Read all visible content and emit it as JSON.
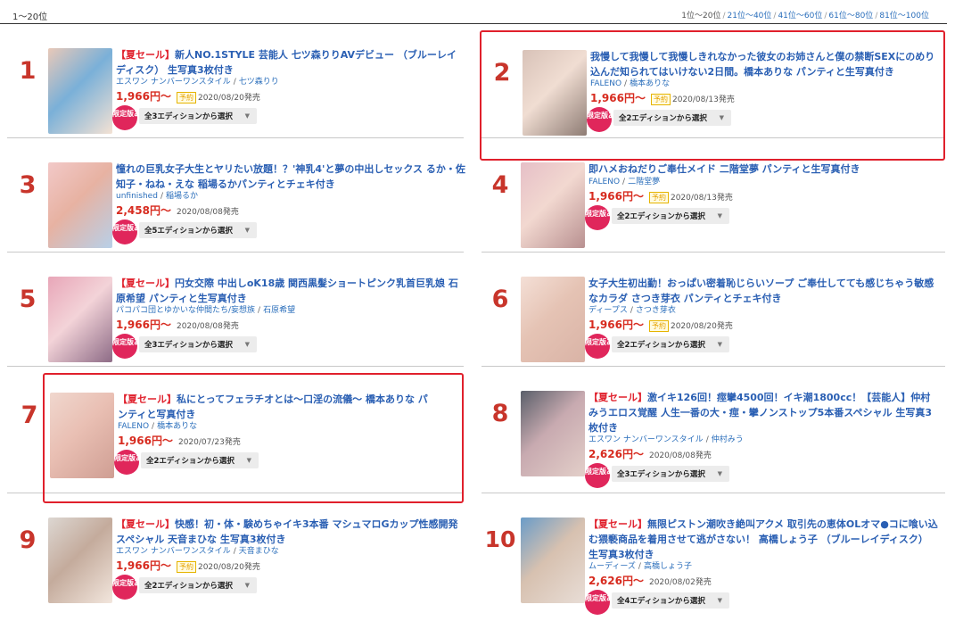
{
  "header": {
    "range_label": "1〜20位",
    "pagination": [
      {
        "label": "1位〜20位",
        "current": true
      },
      {
        "label": "21位〜40位",
        "current": false
      },
      {
        "label": "41位〜60位",
        "current": false
      },
      {
        "label": "61位〜80位",
        "current": false
      },
      {
        "label": "81位〜100位",
        "current": false
      }
    ]
  },
  "colors": {
    "accent_red": "#e0202c",
    "link_blue": "#2a5fb3",
    "rank_red": "#c8352b",
    "badge_pink": "#e0265b",
    "price_red": "#d72b1f"
  },
  "ui": {
    "limited_badge": "限定版あり",
    "dropdown_arrow": "▼",
    "slash": "/"
  },
  "items": [
    {
      "rank": "1",
      "sale": "【夏セール】",
      "title": "新人NO.1STYLE 芸能人 七ツ森りりAVデビュー （ブルーレイディスク） 生写真3枚付き",
      "maker": "エスワン ナンバーワンスタイル",
      "actress": "七ツ森りり",
      "price": "1,966円〜",
      "reserve": "予約",
      "date": "2020/08/20発売",
      "edition": "全3エディションから選択",
      "highlighted": false
    },
    {
      "rank": "2",
      "sale": "",
      "title": "我慢して我慢して我慢しきれなかった彼女のお姉さんと僕の禁断SEXにのめり込んだ知られてはいけない2日間。橋本ありな パンティと生写真付き",
      "maker": "FALENO",
      "actress": "橋本ありな",
      "price": "1,966円〜",
      "reserve": "予約",
      "date": "2020/08/13発売",
      "edition": "全2エディションから選択",
      "highlighted": true
    },
    {
      "rank": "3",
      "sale": "",
      "title": "憧れの巨乳女子大生とヤリたい放題！？'神乳4'と夢の中出しセックス るか・佐知子・ねね・えな 稲場るかパンティとチェキ付き",
      "maker": "unfinished",
      "actress": "稲場るか",
      "price": "2,458円〜",
      "reserve": "",
      "date": "2020/08/08発売",
      "edition": "全5エディションから選択",
      "highlighted": false
    },
    {
      "rank": "4",
      "sale": "",
      "title": "即ハメおねだりご奉仕メイド 二階堂夢 パンティと生写真付き",
      "maker": "FALENO",
      "actress": "二階堂夢",
      "price": "1,966円〜",
      "reserve": "予約",
      "date": "2020/08/13発売",
      "edition": "全2エディションから選択",
      "highlighted": false
    },
    {
      "rank": "5",
      "sale": "【夏セール】",
      "title": "円女交際 中出しoK18歳 関西黒髪ショートピンク乳首巨乳娘 石原希望 パンティと生写真付き",
      "maker": "パコパコ団とゆかいな仲間たち/妄想族",
      "actress": "石原希望",
      "price": "1,966円〜",
      "reserve": "",
      "date": "2020/08/08発売",
      "edition": "全3エディションから選択",
      "highlighted": false
    },
    {
      "rank": "6",
      "sale": "",
      "title": "女子大生初出勤！おっぱい密着恥じらいソープ ご奉仕してても感じちゃう敏感なカラダ さつき芽衣 パンティとチェキ付き",
      "maker": "ディープス",
      "actress": "さつき芽衣",
      "price": "1,966円〜",
      "reserve": "予約",
      "date": "2020/08/20発売",
      "edition": "全2エディションから選択",
      "highlighted": false
    },
    {
      "rank": "7",
      "sale": "【夏セール】",
      "title": "私にとってフェラチオとは〜口淫の流儀〜 橋本ありな パンティと写真付き",
      "maker": "FALENO",
      "actress": "橋本ありな",
      "price": "1,966円〜",
      "reserve": "",
      "date": "2020/07/23発売",
      "edition": "全2エディションから選択",
      "highlighted": true
    },
    {
      "rank": "8",
      "sale": "【夏セール】",
      "title": "激イキ126回！痙攣4500回！イキ潮1800cc！【芸能人】仲村みうエロス覚醒 人生一番の大・痙・攣ノンストップ5本番スペシャル 生写真3枚付き",
      "maker": "エスワン ナンバーワンスタイル",
      "actress": "仲村みう",
      "price": "2,626円〜",
      "reserve": "",
      "date": "2020/08/08発売",
      "edition": "全3エディションから選択",
      "highlighted": false
    },
    {
      "rank": "9",
      "sale": "【夏セール】",
      "title": "快感！初・体・験めちゃイキ3本番 マシュマロGカップ性感開発スペシャル 天音まひな 生写真3枚付き",
      "maker": "エスワン ナンバーワンスタイル",
      "actress": "天音まひな",
      "price": "1,966円〜",
      "reserve": "予約",
      "date": "2020/08/20発売",
      "edition": "全2エディションから選択",
      "highlighted": false
    },
    {
      "rank": "10",
      "sale": "【夏セール】",
      "title": "無限ピストン潮吹き絶叫アクメ 取引先の恵体OLオマ●コに喰い込む猥褻商品を着用させて逃がさない！ 高橋しょう子 （ブルーレイディスク） 生写真3枚付き",
      "maker": "ムーディーズ",
      "actress": "高橋しょう子",
      "price": "2,626円〜",
      "reserve": "",
      "date": "2020/08/02発売",
      "edition": "全4エディションから選択",
      "highlighted": false
    }
  ]
}
